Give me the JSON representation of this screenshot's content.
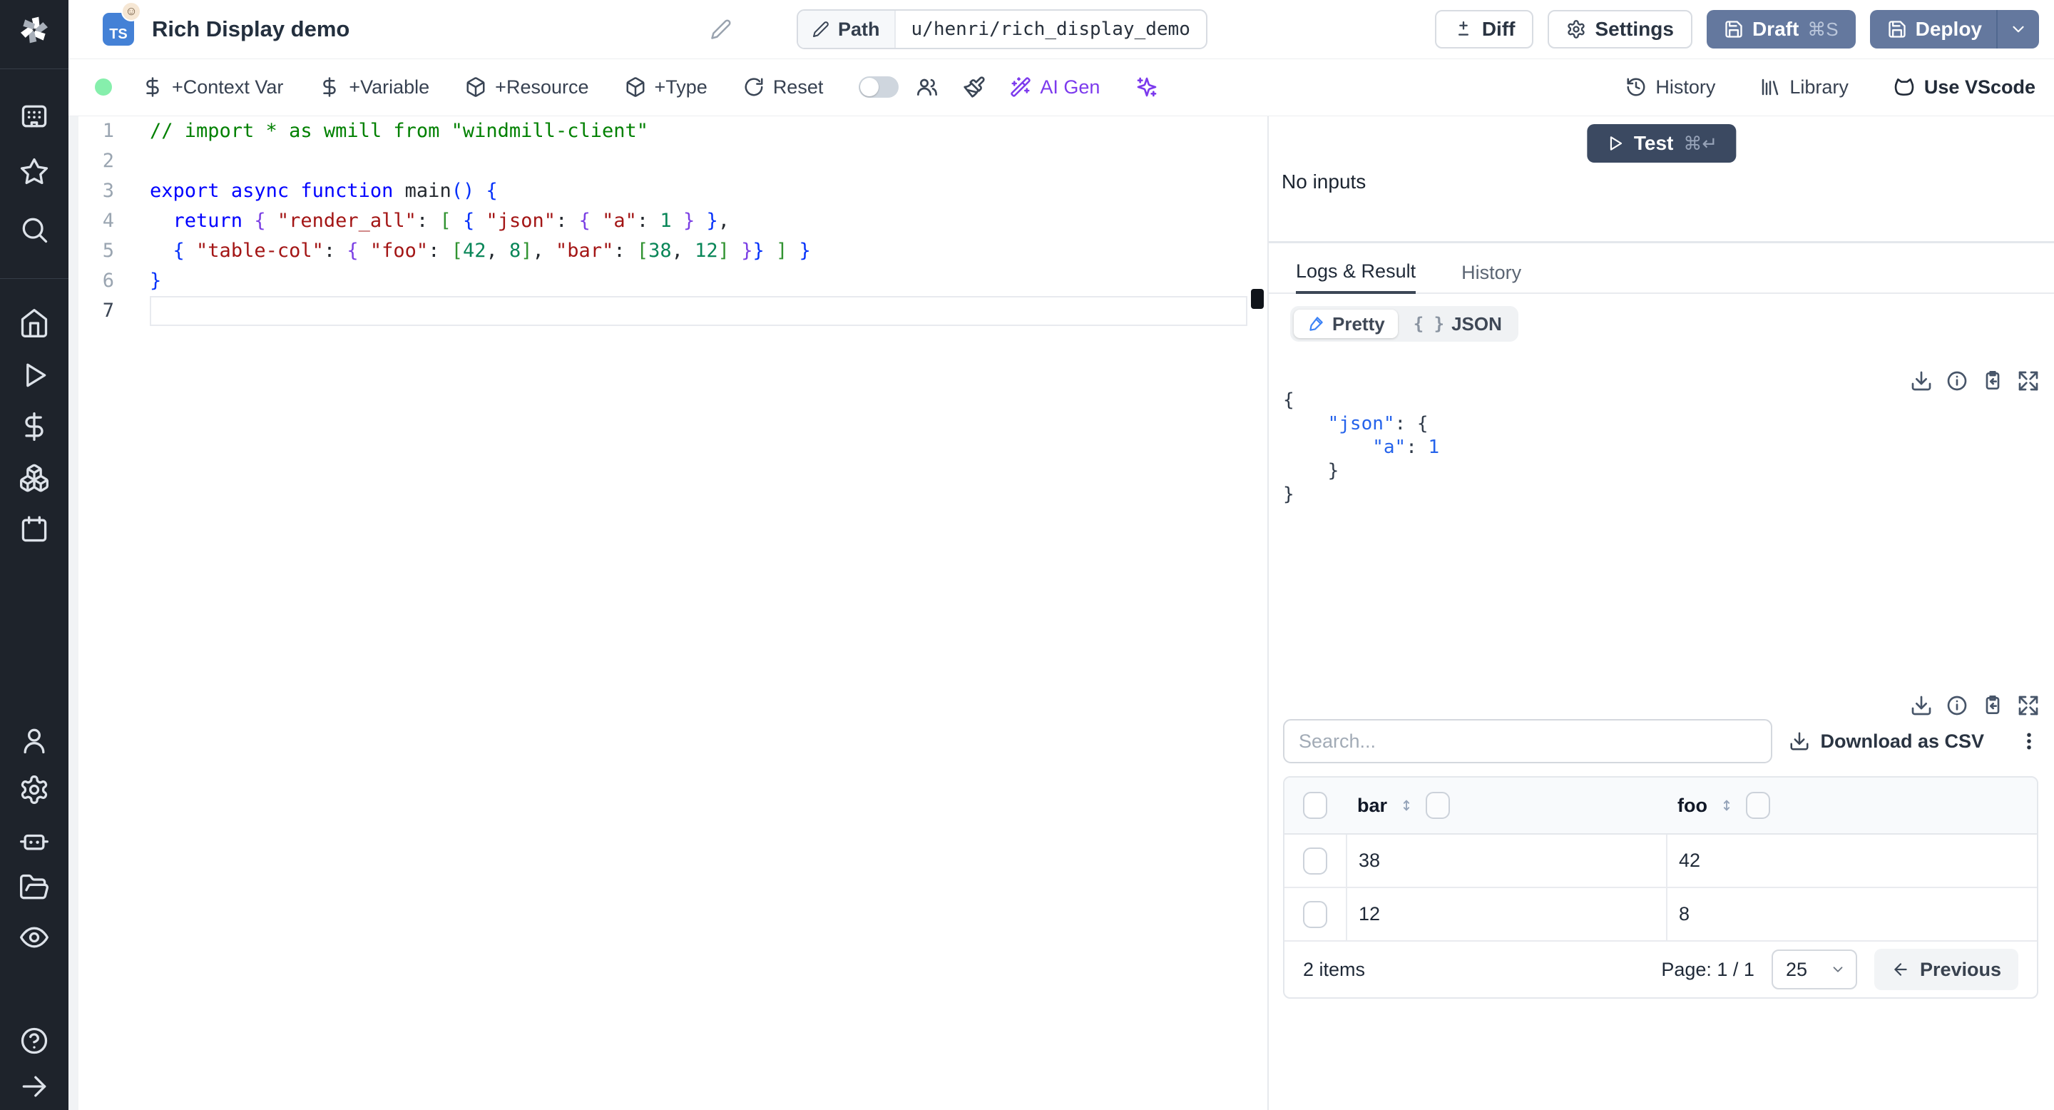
{
  "header": {
    "lang_badge": "TS",
    "title": "Rich Display demo",
    "path_label": "Path",
    "path_value": "u/henri/rich_display_demo",
    "diff": "Diff",
    "settings": "Settings",
    "draft": "Draft",
    "draft_shortcut": "⌘S",
    "deploy": "Deploy"
  },
  "toolbar": {
    "context_var": "+Context Var",
    "variable": "+Variable",
    "resource": "+Resource",
    "type": "+Type",
    "reset": "Reset",
    "ai_gen": "AI Gen",
    "history": "History",
    "library": "Library",
    "vscode": "Use VScode"
  },
  "sidebar": {
    "icons": [
      "windmill-logo",
      "apps",
      "star",
      "search",
      "home",
      "play",
      "dollar",
      "boxes",
      "calendar",
      "user",
      "gear",
      "robot",
      "folder-open",
      "eye",
      "help",
      "arrow-right"
    ]
  },
  "editor": {
    "lines": [
      {
        "n": "1",
        "tokens": [
          [
            "// import * as wmill from \"windmill-client\"",
            "comment"
          ]
        ]
      },
      {
        "n": "2",
        "tokens": []
      },
      {
        "n": "3",
        "tokens": [
          [
            "export",
            "kw"
          ],
          [
            " ",
            "plain"
          ],
          [
            "async",
            "kw"
          ],
          [
            " ",
            "plain"
          ],
          [
            "function",
            "kw"
          ],
          [
            " ",
            "plain"
          ],
          [
            "main",
            "plain"
          ],
          [
            "()",
            "p1"
          ],
          [
            " ",
            "plain"
          ],
          [
            "{",
            "p1"
          ]
        ]
      },
      {
        "n": "4",
        "tokens": [
          [
            "  ",
            "plain"
          ],
          [
            "return",
            "kw"
          ],
          [
            " ",
            "plain"
          ],
          [
            "{",
            "p2"
          ],
          [
            " ",
            "plain"
          ],
          [
            "\"render_all\"",
            "str"
          ],
          [
            ": ",
            "plain"
          ],
          [
            "[",
            "p3"
          ],
          [
            " ",
            "plain"
          ],
          [
            "{",
            "p1"
          ],
          [
            " ",
            "plain"
          ],
          [
            "\"json\"",
            "str"
          ],
          [
            ": ",
            "plain"
          ],
          [
            "{",
            "p2"
          ],
          [
            " ",
            "plain"
          ],
          [
            "\"a\"",
            "str"
          ],
          [
            ": ",
            "plain"
          ],
          [
            "1",
            "num"
          ],
          [
            " ",
            "plain"
          ],
          [
            "}",
            "p2"
          ],
          [
            " ",
            "plain"
          ],
          [
            "}",
            "p1"
          ],
          [
            ",",
            "plain"
          ]
        ]
      },
      {
        "n": "5",
        "tokens": [
          [
            "  ",
            "plain"
          ],
          [
            "{",
            "p1"
          ],
          [
            " ",
            "plain"
          ],
          [
            "\"table-col\"",
            "str"
          ],
          [
            ": ",
            "plain"
          ],
          [
            "{",
            "p2"
          ],
          [
            " ",
            "plain"
          ],
          [
            "\"foo\"",
            "str"
          ],
          [
            ": ",
            "plain"
          ],
          [
            "[",
            "p3"
          ],
          [
            "42",
            "num"
          ],
          [
            ", ",
            "plain"
          ],
          [
            "8",
            "num"
          ],
          [
            "]",
            "p3"
          ],
          [
            ", ",
            "plain"
          ],
          [
            "\"bar\"",
            "str"
          ],
          [
            ": ",
            "plain"
          ],
          [
            "[",
            "p3"
          ],
          [
            "38",
            "num"
          ],
          [
            ", ",
            "plain"
          ],
          [
            "12",
            "num"
          ],
          [
            "]",
            "p3"
          ],
          [
            " ",
            "plain"
          ],
          [
            "}",
            "p2"
          ],
          [
            "}",
            "p1"
          ],
          [
            " ",
            "plain"
          ],
          [
            "]",
            "p3"
          ],
          [
            " ",
            "plain"
          ],
          [
            "}",
            "p1"
          ]
        ]
      },
      {
        "n": "6",
        "tokens": [
          [
            "}",
            "p1"
          ]
        ]
      },
      {
        "n": "7",
        "tokens": [],
        "active": true
      }
    ]
  },
  "panel": {
    "test": "Test",
    "test_shortcut": "⌘↵",
    "no_inputs": "No inputs",
    "tab_logs": "Logs & Result",
    "tab_history": "History",
    "pretty": "Pretty",
    "json": "JSON",
    "result_lines": [
      [
        [
          "{",
          "rb"
        ]
      ],
      [
        [
          "    ",
          "pl"
        ],
        [
          "\"json\"",
          "key"
        ],
        [
          ": ",
          "pl"
        ],
        [
          "{",
          "rb"
        ]
      ],
      [
        [
          "        ",
          "pl"
        ],
        [
          "\"a\"",
          "key"
        ],
        [
          ": ",
          "pl"
        ],
        [
          "1",
          "rv"
        ]
      ],
      [
        [
          "    ",
          "pl"
        ],
        [
          "}",
          "rb"
        ]
      ],
      [
        [
          "}",
          "rb"
        ]
      ]
    ],
    "search_placeholder": "Search...",
    "download_csv": "Download as CSV",
    "table": {
      "columns": [
        "bar",
        "foo"
      ],
      "rows": [
        [
          "38",
          "42"
        ],
        [
          "12",
          "8"
        ]
      ],
      "items_count": "2 items",
      "page": "Page: 1 / 1",
      "page_size": "25",
      "previous": "Previous"
    }
  },
  "colors": {
    "sidebar_bg": "#1e232b",
    "primary_button": "#64789e",
    "test_button": "#3b4961",
    "accent_purple": "#7c3aed",
    "status_green": "#86efac",
    "ts_badge_blue": "#4481d6"
  }
}
